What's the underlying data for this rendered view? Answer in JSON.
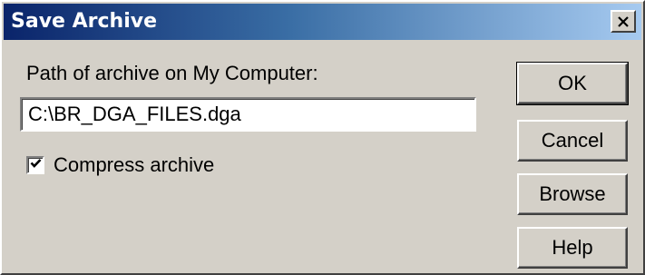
{
  "window": {
    "title": "Save Archive"
  },
  "form": {
    "path_label": "Path of archive on My Computer:",
    "path_value": "C:\\BR_DGA_FILES.dga",
    "compress_label": "Compress archive",
    "compress_checked": true
  },
  "buttons": {
    "ok": "OK",
    "cancel": "Cancel",
    "browse": "Browse",
    "help": "Help"
  },
  "icons": {
    "close": "close-icon",
    "checkmark": "checkmark-icon"
  },
  "colors": {
    "titlebar_start": "#0a246a",
    "titlebar_end": "#a6caf0",
    "face": "#d4d0c8"
  }
}
